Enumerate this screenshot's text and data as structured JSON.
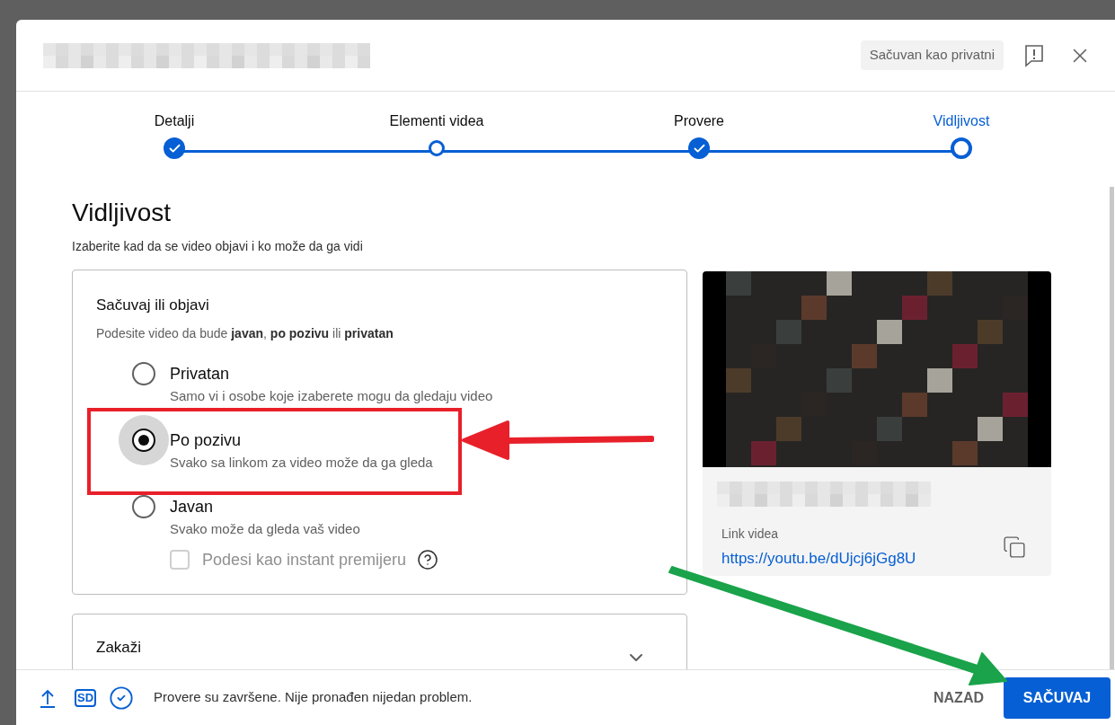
{
  "header": {
    "status_badge": "Sačuvan kao privatni"
  },
  "steps": [
    {
      "label": "Detalji",
      "completed": true,
      "selected": false
    },
    {
      "label": "Elementi videa",
      "completed": false,
      "selected": false
    },
    {
      "label": "Provere",
      "completed": true,
      "selected": false
    },
    {
      "label": "Vidljivost",
      "completed": false,
      "selected": true
    }
  ],
  "visibility": {
    "title": "Vidljivost",
    "subtitle": "Izaberite kad da se video objavi i ko može da ga vidi",
    "save_card": {
      "title": "Sačuvaj ili objavi",
      "description": "Podesite video da bude **javan**, **po pozivu** ili **privatan**",
      "options": [
        {
          "label": "Privatan",
          "description": "Samo vi i osobe koje izaberete mogu da gledaju video",
          "selected": false
        },
        {
          "label": "Po pozivu",
          "description": "Svako sa linkom za video može da ga gleda",
          "selected": true
        },
        {
          "label": "Javan",
          "description": "Svako može da gleda vaš video",
          "selected": false
        }
      ],
      "premiere": {
        "label": "Podesi kao instant premijeru",
        "checked": false,
        "disabled": true
      }
    },
    "schedule_card": {
      "title": "Zakaži",
      "expanded": false
    }
  },
  "preview": {
    "link_label": "Link videa",
    "link": "https://youtu.be/dUjcj6jGg8U"
  },
  "footer": {
    "quality_badge": "SD",
    "status": "Provere su završene. Nije pronađen nijedan problem.",
    "buttons": [
      {
        "label": "NAZAD",
        "kind": "text"
      },
      {
        "label": "SAČUVAJ",
        "kind": "primary"
      }
    ]
  }
}
